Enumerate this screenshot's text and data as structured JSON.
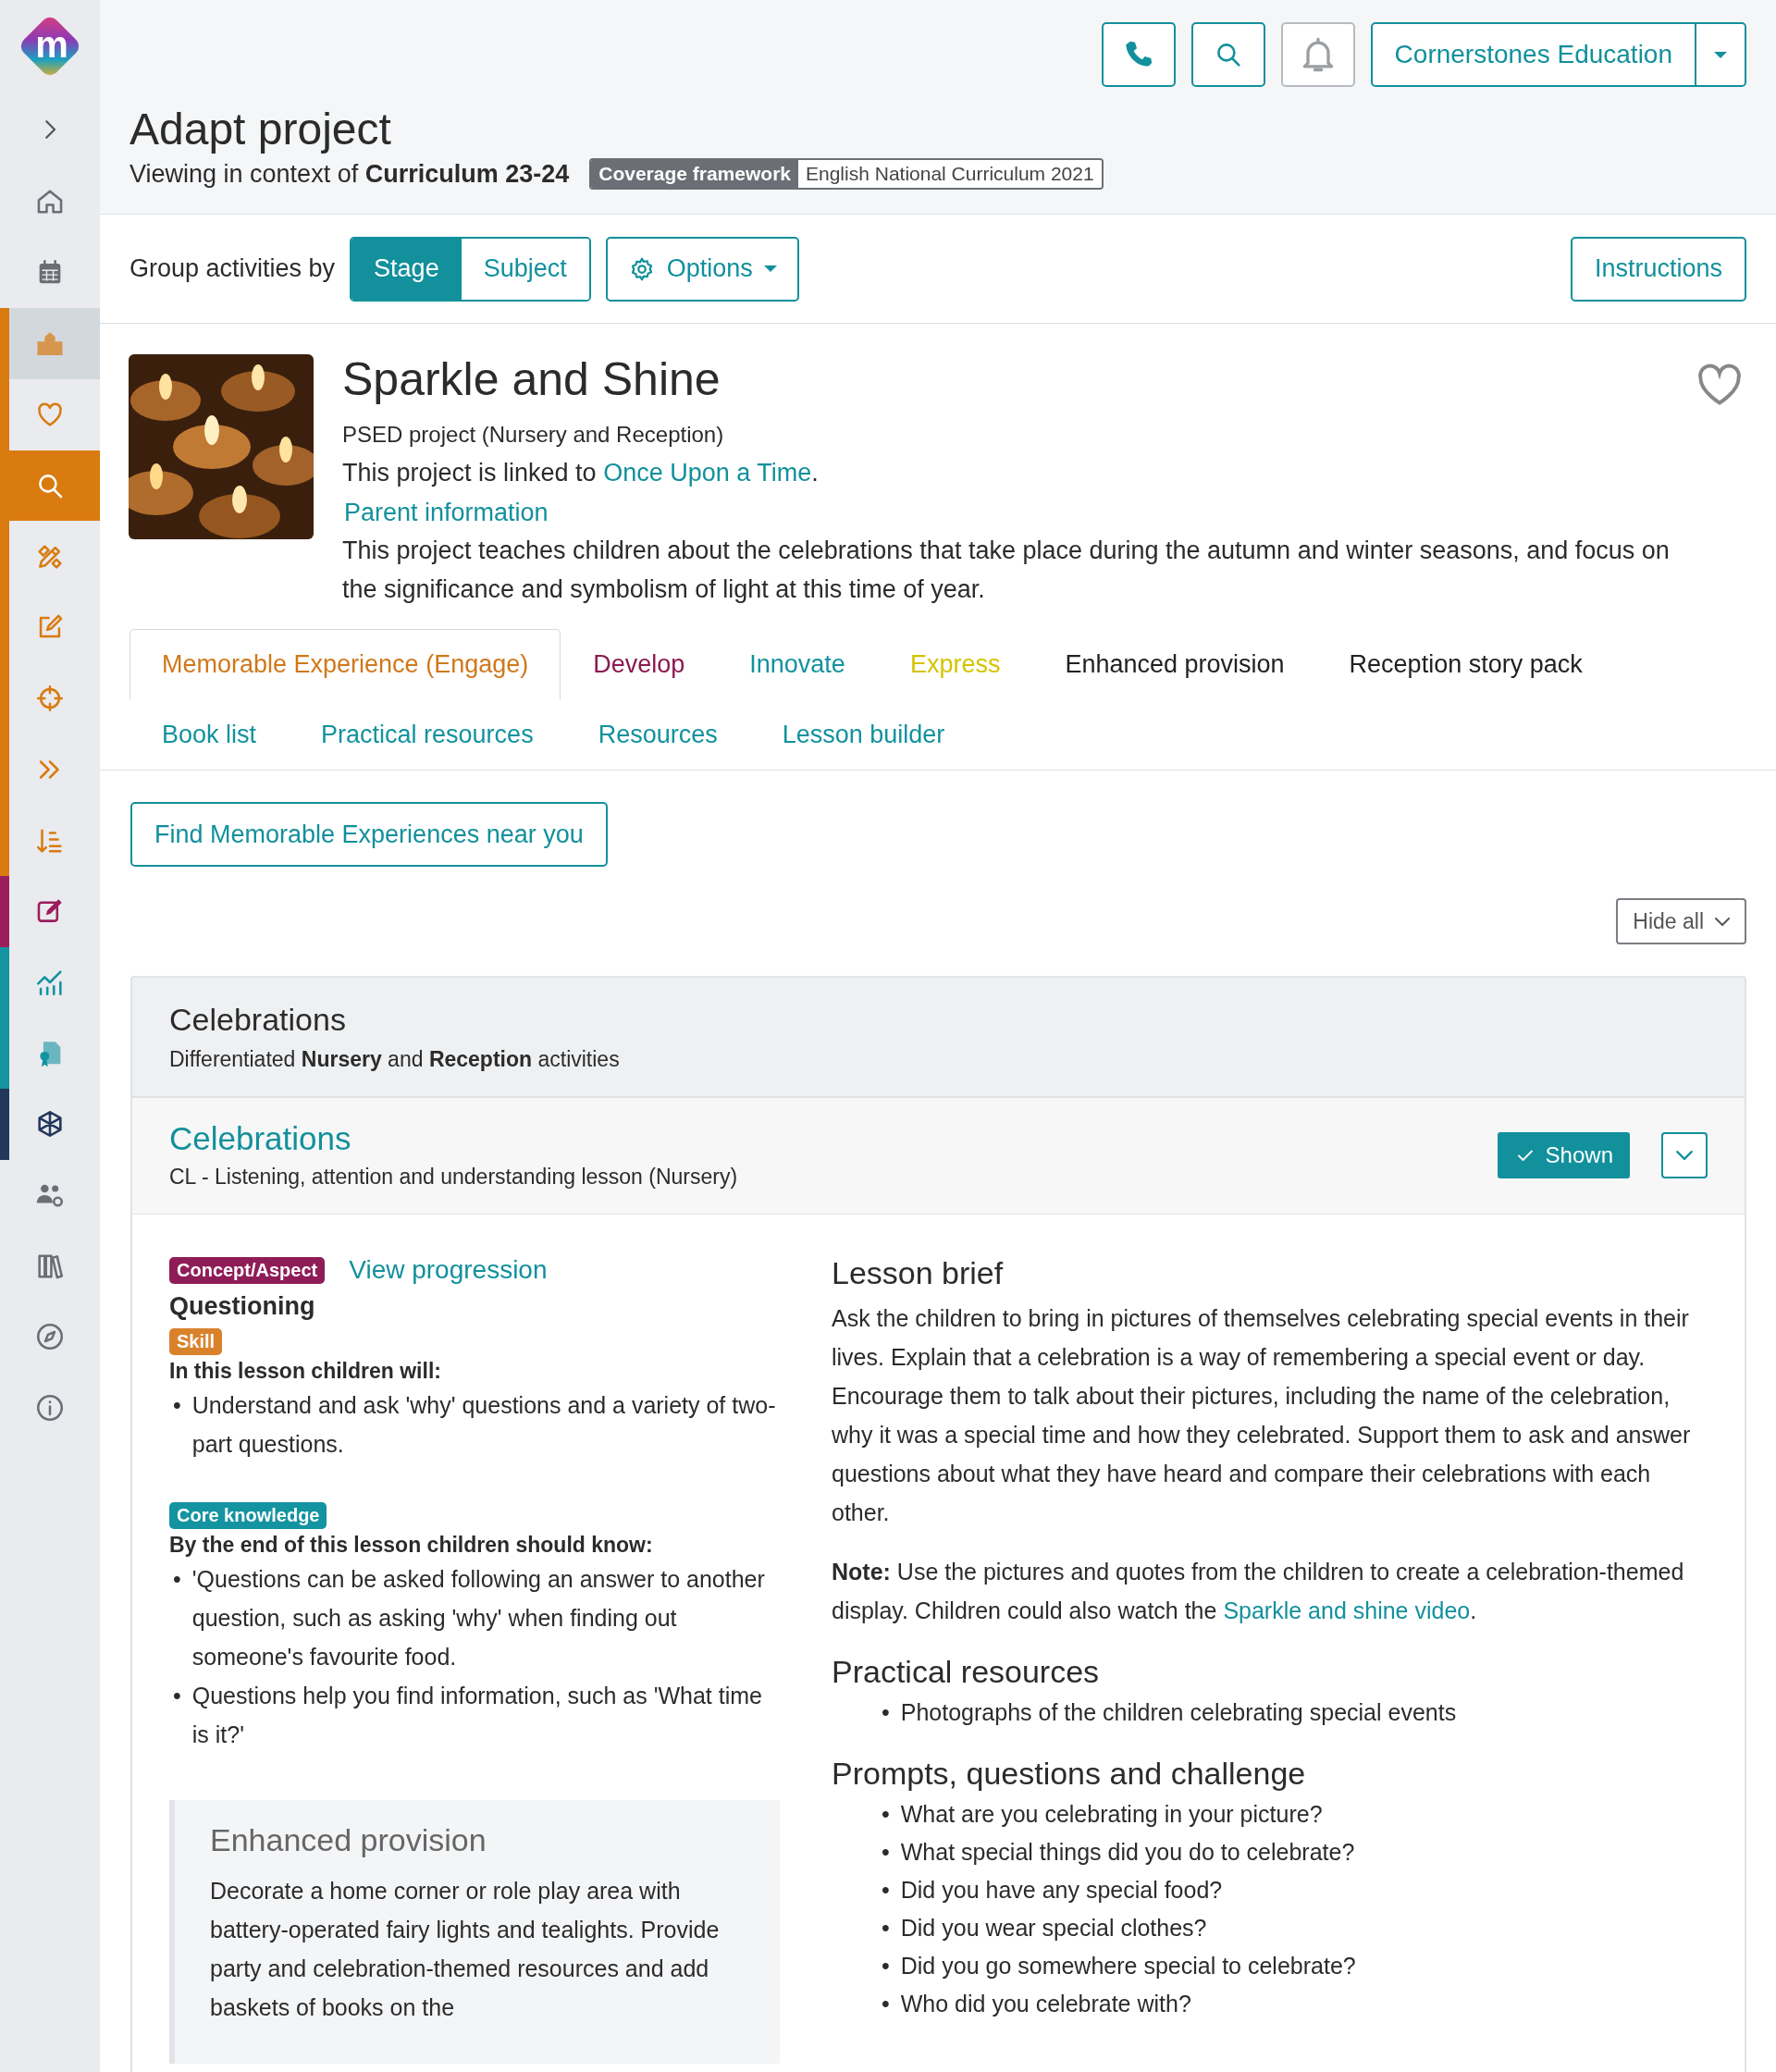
{
  "sidebar": {
    "logo": "m",
    "items": [
      {
        "selected": false,
        "current": false
      },
      {
        "selected": false,
        "current": false
      },
      {
        "selected": false,
        "current": true,
        "color": "#d97b0f"
      },
      {
        "selected": false,
        "current": false,
        "color": "#d97b0f"
      },
      {
        "selected": true,
        "current": false,
        "color": "#d97b0f"
      },
      {
        "selected": false,
        "current": false,
        "color": "#d97b0f"
      },
      {
        "selected": false,
        "current": false,
        "color": "#d97b0f"
      },
      {
        "selected": false,
        "current": false,
        "color": "#d97b0f"
      },
      {
        "selected": false,
        "current": false,
        "color": "#d97b0f"
      },
      {
        "selected": false,
        "current": false,
        "color": "#d97b0f"
      },
      {
        "selected": false,
        "current": false,
        "color": "#9c1d5c"
      },
      {
        "selected": false,
        "current": false,
        "color": "#1493a0"
      },
      {
        "selected": false,
        "current": false,
        "color": "#1493a0"
      },
      {
        "selected": false,
        "current": false,
        "color": "#22375a"
      },
      {
        "selected": false,
        "current": false
      },
      {
        "selected": false,
        "current": false
      },
      {
        "selected": false,
        "current": false
      },
      {
        "selected": false,
        "current": false
      }
    ]
  },
  "header": {
    "title": "Adapt project",
    "context": "Viewing in context of **Curriculum 23-24**",
    "framework": {
      "label": "Coverage framework",
      "value": "English National Curriculum 2021"
    },
    "account": "Cornerstones Education"
  },
  "toolbar": {
    "group_label": "Group activities by",
    "group_options": [
      {
        "label": "Stage",
        "selected": true
      },
      {
        "label": "Subject",
        "selected": false
      }
    ],
    "options": "Options",
    "instructions": "Instructions"
  },
  "project": {
    "title": "Sparkle and Shine",
    "subtitle": "PSED project (Nursery and Reception)",
    "linked_prefix": "This project is linked to",
    "linked_link": "Once Upon a Time",
    "linked_suffix": ".",
    "parent_link": "Parent information",
    "description": "This project teaches children about the celebrations that take place during the autumn and winter seasons, and focus on the significance and symbolism of light at this time of year.",
    "favourite": false
  },
  "tab_rows": [
    [
      {
        "label": "Memorable Experience (Engage)",
        "selected": true,
        "color": "#d0781a"
      },
      {
        "label": "Develop",
        "selected": false,
        "color": "#8b1a4f"
      },
      {
        "label": "Innovate",
        "selected": false,
        "color": "#12929e"
      },
      {
        "label": "Express",
        "selected": false,
        "color": "#d4c400"
      },
      {
        "label": "Enhanced provision",
        "selected": false,
        "color": "#222222"
      },
      {
        "label": "Reception story pack",
        "selected": false,
        "color": "#222222"
      }
    ],
    [
      {
        "label": "Book list",
        "selected": false,
        "color": "#12929e"
      },
      {
        "label": "Practical resources",
        "selected": false,
        "color": "#12929e"
      },
      {
        "label": "Resources",
        "selected": false,
        "color": "#12929e"
      },
      {
        "label": "Lesson builder",
        "selected": false,
        "color": "#12929e"
      }
    ]
  ],
  "find_button": "Find Memorable Experiences near you",
  "hide_all": "Hide all",
  "section": {
    "title": "Celebrations",
    "subtitle": "Differentiated **Nursery** and **Reception** activities"
  },
  "lesson": {
    "title": "Celebrations",
    "subtitle": "CL - Listening, attention and understanding lesson (Nursery)",
    "shown": true,
    "visibility_label": "Shown",
    "concept": {
      "tag": "Concept/Aspect",
      "link": "View progression",
      "value": "Questioning"
    },
    "objectives": [
      {
        "kind": "skill",
        "tag": "Skill",
        "intro": "In this lesson children will:",
        "points": [
          "Understand and ask 'why' questions and a variety of two-part questions."
        ]
      },
      {
        "kind": "knowledge",
        "tag": "Core knowledge",
        "intro": "By the end of this lesson children should know:",
        "points": [
          "'Questions can be asked following an answer to another question, such as asking 'why' when finding out someone's favourite food.",
          "Questions help you find information, such as 'What time is it?'"
        ]
      }
    ],
    "enhanced": {
      "title": "Enhanced provision",
      "text": "Decorate a home corner or role play area with battery-operated fairy lights and tealights. Provide party and celebration-themed resources and add baskets of books on the"
    },
    "brief": {
      "title": "Lesson brief",
      "text": "Ask the children to bring in pictures of themselves celebrating special events in their lives. Explain that a celebration is a way of remembering a special event or day. Encourage them to talk about their pictures, including the name of the celebration, why it was a special time and how they celebrated. Support them to ask and answer questions about what they have heard and compare their celebrations with each other.",
      "note": "**Note:** Use the pictures and quotes from the children to create a celebration-themed display. Children could also watch the",
      "note_link": "Sparkle and shine video",
      "note_end": "."
    },
    "bullet": "•",
    "practical": {
      "title": "Practical resources",
      "items": [
        "Photographs of the children celebrating special events"
      ]
    },
    "prompts": {
      "title": "Prompts, questions and challenge",
      "items": [
        "What are you celebrating in your picture?",
        "What special things did you do to celebrate?",
        "Did you have any special food?",
        "Did you wear special clothes?",
        "Did you go somewhere special to celebrate?",
        "Who did you celebrate with?"
      ]
    }
  }
}
